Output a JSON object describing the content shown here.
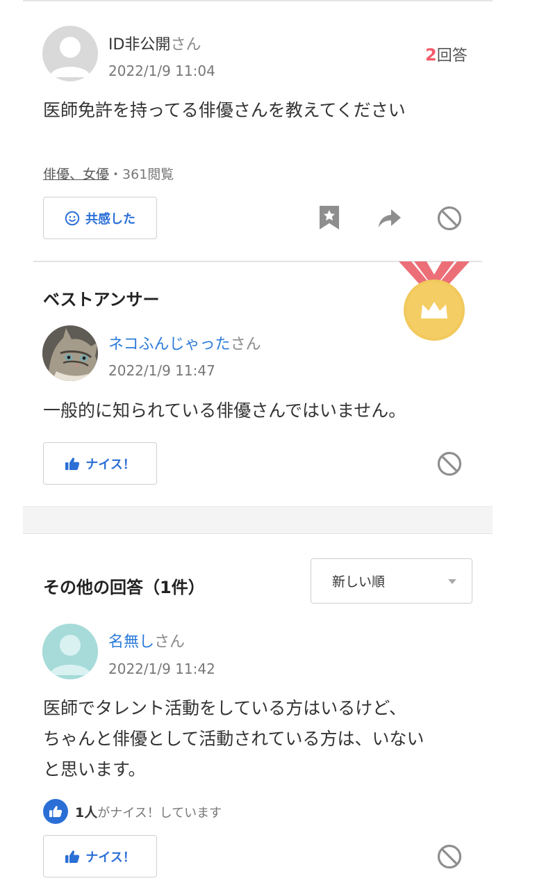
{
  "question": {
    "user_name": "ID非公開",
    "san": "さん",
    "date": "2022/1/9 11:04",
    "answers_num": "2",
    "answers_label": "回答",
    "text": "医師免許を持ってる俳優さんを教えてください",
    "tag": "俳優、女優",
    "views": "・361閲覧",
    "empathy_label": "共感した"
  },
  "best_answer": {
    "section_title": "ベストアンサー",
    "user_name": "ネコふんじゃった",
    "san": "さん",
    "date": "2022/1/9 11:47",
    "text": "一般的に知られている俳優さんではいません。",
    "nice_label": "ナイス！"
  },
  "other_answers": {
    "section_title": "その他の回答（1件）",
    "sort_value": "新しい順",
    "answer": {
      "user_name": "名無し",
      "san": "さん",
      "date": "2022/1/9 11:42",
      "text_lines": [
        "医師でタレント活動をしている方はいるけど、",
        "ちゃんと俳優として活動されている方は、いない",
        "と思います。"
      ],
      "nice_count": "1人",
      "nice_count_suffix": "がナイス！しています",
      "nice_label": "ナイス！"
    }
  },
  "colors": {
    "accent_blue": "#2b6fd6",
    "link_blue": "#2b7bd8",
    "count_red": "#f25a6a",
    "medal_gold": "#f4c95a",
    "ribbon_red": "#ec6f78"
  }
}
